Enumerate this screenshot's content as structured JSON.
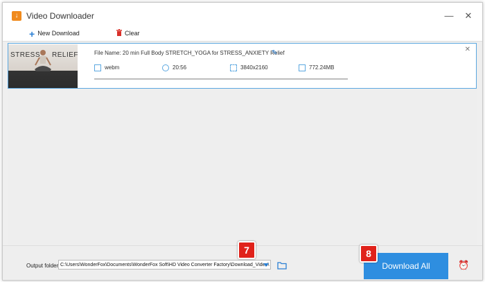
{
  "window": {
    "title": "Video Downloader",
    "minimize": "—",
    "close": "✕",
    "app_icon": "↓"
  },
  "toolbar": {
    "new_download_icon": "+",
    "new_download_label": "New Download",
    "clear_icon": "🗑",
    "clear_label": "Clear"
  },
  "item": {
    "thumb_left": "STRESS",
    "thumb_right": "RELIEF",
    "file_name": "File Name: 20 min Full Body STRETCH_YOGA for STRESS_ANXIETY Relief",
    "edit_icon": "✎",
    "close_icon": "✕",
    "format": "webm",
    "duration": "20:56",
    "resolution": "3840x2160",
    "size": "772.24MB"
  },
  "bottom": {
    "output_label": "Output folder:",
    "output_path": "C:\\Users\\WonderFox\\Documents\\WonderFox Soft\\HD Video Converter Factory\\Download_Video\\",
    "download_all_label": "Download All",
    "alarm_icon": "⏰"
  },
  "annotations": {
    "badge_7": "7",
    "badge_8": "8"
  },
  "colors": {
    "accent": "#2e8ee0",
    "badge": "#e0221b",
    "app_icon": "#f08a1d"
  }
}
